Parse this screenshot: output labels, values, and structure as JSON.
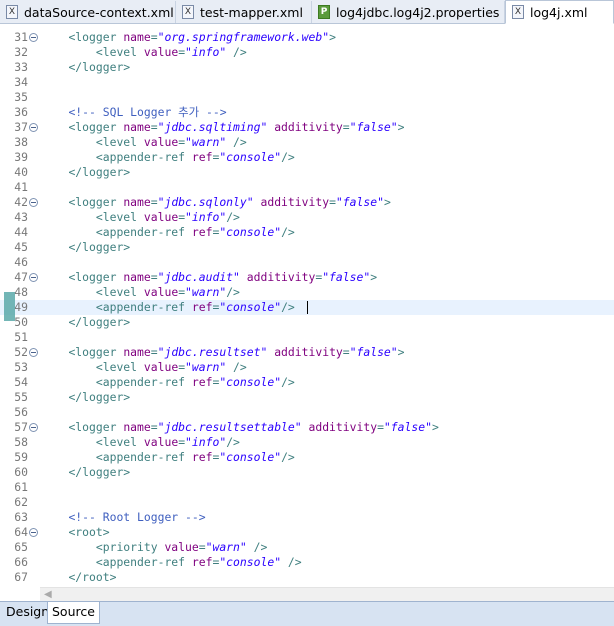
{
  "tabs": [
    {
      "label": "dataSource-context.xml",
      "icon": "xml-file-icon",
      "icon_text": "X"
    },
    {
      "label": "test-mapper.xml",
      "icon": "xml-file-icon",
      "icon_text": "X"
    },
    {
      "label": "log4jdbc.log4j2.properties",
      "icon": "properties-file-icon",
      "icon_text": "P"
    },
    {
      "label": "log4j.xml",
      "icon": "xml-file-icon",
      "icon_text": "X",
      "active": true
    }
  ],
  "editor": {
    "current_line": 49,
    "lines": [
      {
        "n": "31",
        "fold": true,
        "t": [
          [
            "    ",
            ""
          ],
          [
            "<logger ",
            "tag"
          ],
          [
            "name",
            "at"
          ],
          [
            "=",
            "tag"
          ],
          [
            "\"org.springframework.web\"",
            "val"
          ],
          [
            ">",
            "tag"
          ]
        ]
      },
      {
        "n": "32",
        "t": [
          [
            "        ",
            ""
          ],
          [
            "<level ",
            "tag"
          ],
          [
            "value",
            "at"
          ],
          [
            "=",
            "tag"
          ],
          [
            "\"info\"",
            "val"
          ],
          [
            " />",
            "tag"
          ]
        ]
      },
      {
        "n": "33",
        "t": [
          [
            "    ",
            ""
          ],
          [
            "</logger>",
            "tag"
          ]
        ]
      },
      {
        "n": "34",
        "t": []
      },
      {
        "n": "35",
        "t": []
      },
      {
        "n": "36",
        "t": [
          [
            "    ",
            ""
          ],
          [
            "<!-- SQL Logger 추가 -->",
            "cm"
          ]
        ]
      },
      {
        "n": "37",
        "fold": true,
        "t": [
          [
            "    ",
            ""
          ],
          [
            "<logger ",
            "tag"
          ],
          [
            "name",
            "at"
          ],
          [
            "=",
            "tag"
          ],
          [
            "\"jdbc.sqltiming\"",
            "val"
          ],
          [
            " ",
            "tag"
          ],
          [
            "additivity",
            "at"
          ],
          [
            "=",
            "tag"
          ],
          [
            "\"false\"",
            "val"
          ],
          [
            ">",
            "tag"
          ]
        ]
      },
      {
        "n": "38",
        "t": [
          [
            "        ",
            ""
          ],
          [
            "<level ",
            "tag"
          ],
          [
            "value",
            "at"
          ],
          [
            "=",
            "tag"
          ],
          [
            "\"warn\"",
            "val"
          ],
          [
            " />",
            "tag"
          ]
        ]
      },
      {
        "n": "39",
        "t": [
          [
            "        ",
            ""
          ],
          [
            "<appender-ref ",
            "tag"
          ],
          [
            "ref",
            "at"
          ],
          [
            "=",
            "tag"
          ],
          [
            "\"console\"",
            "val"
          ],
          [
            "/>",
            "tag"
          ]
        ]
      },
      {
        "n": "40",
        "t": [
          [
            "    ",
            ""
          ],
          [
            "</logger>",
            "tag"
          ]
        ]
      },
      {
        "n": "41",
        "t": []
      },
      {
        "n": "42",
        "fold": true,
        "t": [
          [
            "    ",
            ""
          ],
          [
            "<logger ",
            "tag"
          ],
          [
            "name",
            "at"
          ],
          [
            "=",
            "tag"
          ],
          [
            "\"jdbc.sqlonly\"",
            "val"
          ],
          [
            " ",
            "tag"
          ],
          [
            "additivity",
            "at"
          ],
          [
            "=",
            "tag"
          ],
          [
            "\"false\"",
            "val"
          ],
          [
            ">",
            "tag"
          ]
        ]
      },
      {
        "n": "43",
        "t": [
          [
            "        ",
            ""
          ],
          [
            "<level ",
            "tag"
          ],
          [
            "value",
            "at"
          ],
          [
            "=",
            "tag"
          ],
          [
            "\"info\"",
            "val"
          ],
          [
            "/>",
            "tag"
          ]
        ]
      },
      {
        "n": "44",
        "t": [
          [
            "        ",
            ""
          ],
          [
            "<appender-ref ",
            "tag"
          ],
          [
            "ref",
            "at"
          ],
          [
            "=",
            "tag"
          ],
          [
            "\"console\"",
            "val"
          ],
          [
            "/>",
            "tag"
          ]
        ]
      },
      {
        "n": "45",
        "t": [
          [
            "    ",
            ""
          ],
          [
            "</logger>",
            "tag"
          ]
        ]
      },
      {
        "n": "46",
        "t": []
      },
      {
        "n": "47",
        "fold": true,
        "t": [
          [
            "    ",
            ""
          ],
          [
            "<logger ",
            "tag"
          ],
          [
            "name",
            "at"
          ],
          [
            "=",
            "tag"
          ],
          [
            "\"jdbc.audit\"",
            "val"
          ],
          [
            " ",
            "tag"
          ],
          [
            "additivity",
            "at"
          ],
          [
            "=",
            "tag"
          ],
          [
            "\"false\"",
            "val"
          ],
          [
            ">",
            "tag"
          ]
        ]
      },
      {
        "n": "48",
        "t": [
          [
            "        ",
            ""
          ],
          [
            "<level ",
            "tag"
          ],
          [
            "value",
            "at"
          ],
          [
            "=",
            "tag"
          ],
          [
            "\"warn\"",
            "val"
          ],
          [
            "/>",
            "tag"
          ]
        ]
      },
      {
        "n": "49",
        "t": [
          [
            "        ",
            ""
          ],
          [
            "<appender-ref ",
            "tag"
          ],
          [
            "ref",
            "at"
          ],
          [
            "=",
            "tag"
          ],
          [
            "\"console\"",
            "val"
          ],
          [
            "/> ",
            "tag"
          ]
        ]
      },
      {
        "n": "50",
        "t": [
          [
            "    ",
            ""
          ],
          [
            "</logger>",
            "tag"
          ]
        ]
      },
      {
        "n": "51",
        "t": []
      },
      {
        "n": "52",
        "fold": true,
        "t": [
          [
            "    ",
            ""
          ],
          [
            "<logger ",
            "tag"
          ],
          [
            "name",
            "at"
          ],
          [
            "=",
            "tag"
          ],
          [
            "\"jdbc.resultset\"",
            "val"
          ],
          [
            " ",
            "tag"
          ],
          [
            "additivity",
            "at"
          ],
          [
            "=",
            "tag"
          ],
          [
            "\"false\"",
            "val"
          ],
          [
            ">",
            "tag"
          ]
        ]
      },
      {
        "n": "53",
        "t": [
          [
            "        ",
            ""
          ],
          [
            "<level ",
            "tag"
          ],
          [
            "value",
            "at"
          ],
          [
            "=",
            "tag"
          ],
          [
            "\"warn\"",
            "val"
          ],
          [
            " />",
            "tag"
          ]
        ]
      },
      {
        "n": "54",
        "t": [
          [
            "        ",
            ""
          ],
          [
            "<appender-ref ",
            "tag"
          ],
          [
            "ref",
            "at"
          ],
          [
            "=",
            "tag"
          ],
          [
            "\"console\"",
            "val"
          ],
          [
            "/>",
            "tag"
          ]
        ]
      },
      {
        "n": "55",
        "t": [
          [
            "    ",
            ""
          ],
          [
            "</logger>",
            "tag"
          ]
        ]
      },
      {
        "n": "56",
        "t": []
      },
      {
        "n": "57",
        "fold": true,
        "t": [
          [
            "    ",
            ""
          ],
          [
            "<logger ",
            "tag"
          ],
          [
            "name",
            "at"
          ],
          [
            "=",
            "tag"
          ],
          [
            "\"jdbc.resultsettable\"",
            "val"
          ],
          [
            " ",
            "tag"
          ],
          [
            "additivity",
            "at"
          ],
          [
            "=",
            "tag"
          ],
          [
            "\"false\"",
            "val"
          ],
          [
            ">",
            "tag"
          ]
        ]
      },
      {
        "n": "58",
        "t": [
          [
            "        ",
            ""
          ],
          [
            "<level ",
            "tag"
          ],
          [
            "value",
            "at"
          ],
          [
            "=",
            "tag"
          ],
          [
            "\"info\"",
            "val"
          ],
          [
            "/>",
            "tag"
          ]
        ]
      },
      {
        "n": "59",
        "t": [
          [
            "        ",
            ""
          ],
          [
            "<appender-ref ",
            "tag"
          ],
          [
            "ref",
            "at"
          ],
          [
            "=",
            "tag"
          ],
          [
            "\"console\"",
            "val"
          ],
          [
            "/>",
            "tag"
          ]
        ]
      },
      {
        "n": "60",
        "t": [
          [
            "    ",
            ""
          ],
          [
            "</logger>",
            "tag"
          ]
        ]
      },
      {
        "n": "61",
        "t": []
      },
      {
        "n": "62",
        "t": []
      },
      {
        "n": "63",
        "t": [
          [
            "    ",
            ""
          ],
          [
            "<!-- Root Logger -->",
            "cm"
          ]
        ]
      },
      {
        "n": "64",
        "fold": true,
        "t": [
          [
            "    ",
            ""
          ],
          [
            "<root>",
            "tag"
          ]
        ]
      },
      {
        "n": "65",
        "t": [
          [
            "        ",
            ""
          ],
          [
            "<priority ",
            "tag"
          ],
          [
            "value",
            "at"
          ],
          [
            "=",
            "tag"
          ],
          [
            "\"warn\"",
            "val"
          ],
          [
            " />",
            "tag"
          ]
        ]
      },
      {
        "n": "66",
        "t": [
          [
            "        ",
            ""
          ],
          [
            "<appender-ref ",
            "tag"
          ],
          [
            "ref",
            "at"
          ],
          [
            "=",
            "tag"
          ],
          [
            "\"console\"",
            "val"
          ],
          [
            " />",
            "tag"
          ]
        ]
      },
      {
        "n": "67",
        "t": [
          [
            "    ",
            ""
          ],
          [
            "</root>",
            "tag"
          ]
        ]
      }
    ]
  },
  "bottom_tabs": [
    {
      "label": "Design"
    },
    {
      "label": "Source",
      "active": true
    }
  ],
  "colors": {
    "tag": "#3f7f7f",
    "attribute": "#7f007f",
    "value": "#2a00ff",
    "comment": "#3f5fbf",
    "line_number": "#787878",
    "current_line": "#e8f2fe"
  }
}
